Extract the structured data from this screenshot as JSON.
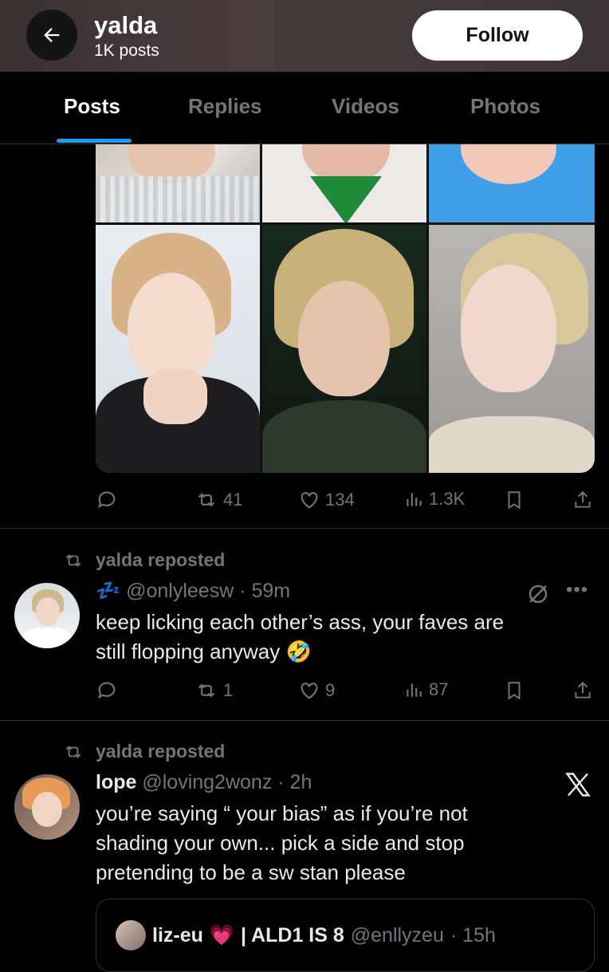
{
  "header": {
    "name": "yalda",
    "posts_count": "1K posts",
    "follow_label": "Follow"
  },
  "tabs": [
    {
      "label": "Posts",
      "active": true
    },
    {
      "label": "Replies",
      "active": false
    },
    {
      "label": "Videos",
      "active": false
    },
    {
      "label": "Photos",
      "active": false
    }
  ],
  "post1": {
    "reposts": "41",
    "likes": "134",
    "views": "1.3K"
  },
  "post2": {
    "repost_label": "yalda reposted",
    "handle_prefix": "💤",
    "handle": "@onlyleesw",
    "time": "· 59m",
    "text_line1": "keep licking each other’s ass, your faves are",
    "text_line2": "still flopping anyway 🤣",
    "reposts": "1",
    "likes": "9",
    "views": "87"
  },
  "post3": {
    "repost_label": "yalda reposted",
    "name": "lope",
    "handle": "@loving2wonz",
    "time": "· 2h",
    "text_line1": "you’re saying “ your bias” as if you’re not",
    "text_line2": "shading your own... pick a side and stop",
    "text_line3": "pretending to be a sw stan please",
    "quote": {
      "name": "liz-eu",
      "name_emoji": "💗",
      "name_suffix": "| ALD1 IS 8",
      "handle": "@enllyzeu",
      "time": "· 15h"
    }
  },
  "colors": {
    "accent": "#1d9bf0",
    "muted": "#71767b",
    "text": "#e7e9ea",
    "border": "#2f3336"
  }
}
